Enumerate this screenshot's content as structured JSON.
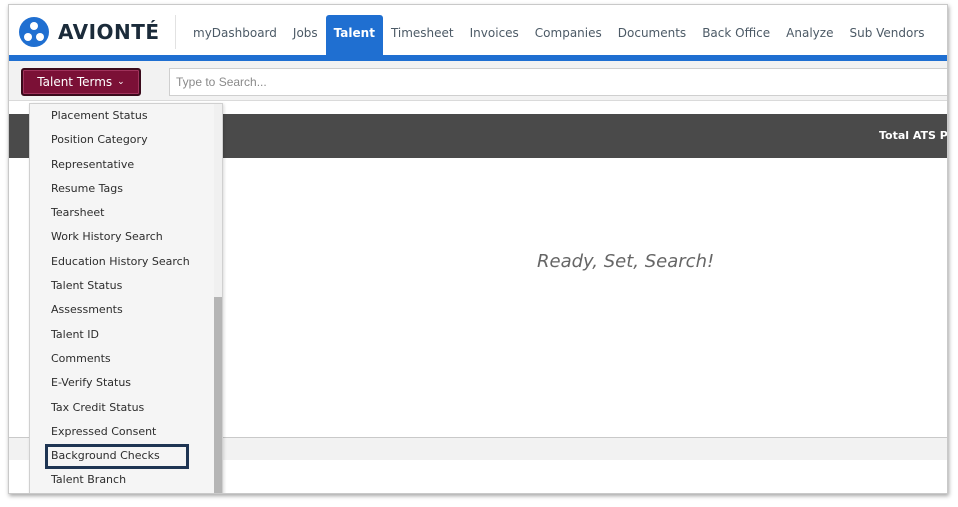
{
  "logo": {
    "text": "AVIONTÉ"
  },
  "nav": {
    "items": [
      {
        "label": "myDashboard"
      },
      {
        "label": "Jobs"
      },
      {
        "label": "Talent",
        "active": true
      },
      {
        "label": "Timesheet"
      },
      {
        "label": "Invoices"
      },
      {
        "label": "Companies"
      },
      {
        "label": "Documents"
      },
      {
        "label": "Back Office"
      },
      {
        "label": "Analyze"
      },
      {
        "label": "Sub Vendors"
      }
    ]
  },
  "search": {
    "terms_button_label": "Talent Terms",
    "placeholder": "Type to Search..."
  },
  "results": {
    "header_label": "Total ATS Pe",
    "empty_message": "Ready, Set, Search!"
  },
  "dropdown": {
    "items": [
      "Placement Status",
      "Position Category",
      "Representative",
      "Resume Tags",
      "Tearsheet",
      "Work History Search",
      "Education History Search",
      "Talent Status",
      "Assessments",
      "Talent ID",
      "Comments",
      "E-Verify Status",
      "Tax Credit Status",
      "Expressed Consent",
      "Background Checks",
      "Talent Branch"
    ],
    "highlighted_item": "Background Checks"
  },
  "colors": {
    "brand_blue": "#1f6fd1",
    "terms_button": "#7b1036",
    "results_band": "#4a4a4a",
    "highlight_border": "#1f3553"
  }
}
